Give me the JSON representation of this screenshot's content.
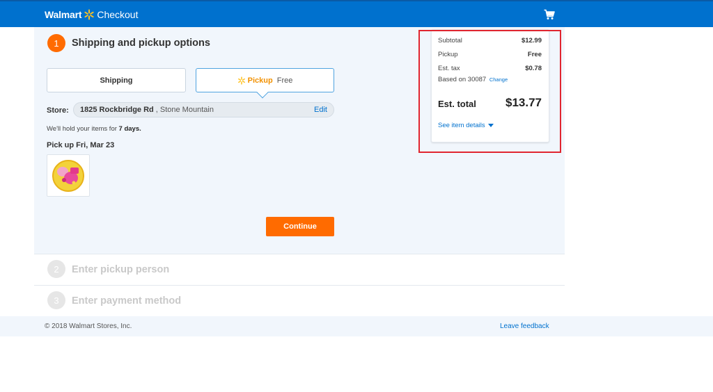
{
  "header": {
    "brand": "Walmart",
    "title": "Checkout"
  },
  "colors": {
    "header_blue": "#0071ce",
    "accent_orange": "#ff6b00",
    "pickup_orange": "#f29100",
    "link_blue": "#0071ce",
    "highlight_red": "#e0252f"
  },
  "step1": {
    "number": "1",
    "title": "Shipping and pickup options",
    "shipping_label": "Shipping",
    "pickup_label": "Pickup",
    "pickup_price": "Free",
    "store_label": "Store:",
    "store_address": "1825 Rockbridge Rd",
    "store_city": ", Stone Mountain",
    "edit_label": "Edit",
    "hold_text": "We'll hold your items for ",
    "hold_days": "7 days.",
    "pickup_date": "Pick up Fri, Mar 23",
    "continue_label": "Continue"
  },
  "step2": {
    "number": "2",
    "title": "Enter pickup person"
  },
  "step3": {
    "number": "3",
    "title": "Enter payment method"
  },
  "summary": {
    "subtotal_label": "Subtotal",
    "subtotal": "$12.99",
    "pickup_label": "Pickup",
    "pickup": "Free",
    "tax_label": "Est. tax",
    "tax": "$0.78",
    "based_on": "Based on 30087",
    "change_label": "Change",
    "total_label": "Est. total",
    "total": "$13.77",
    "details_label": "See item details"
  },
  "footer": {
    "copyright": "© 2018 Walmart Stores, Inc.",
    "feedback": "Leave feedback"
  }
}
